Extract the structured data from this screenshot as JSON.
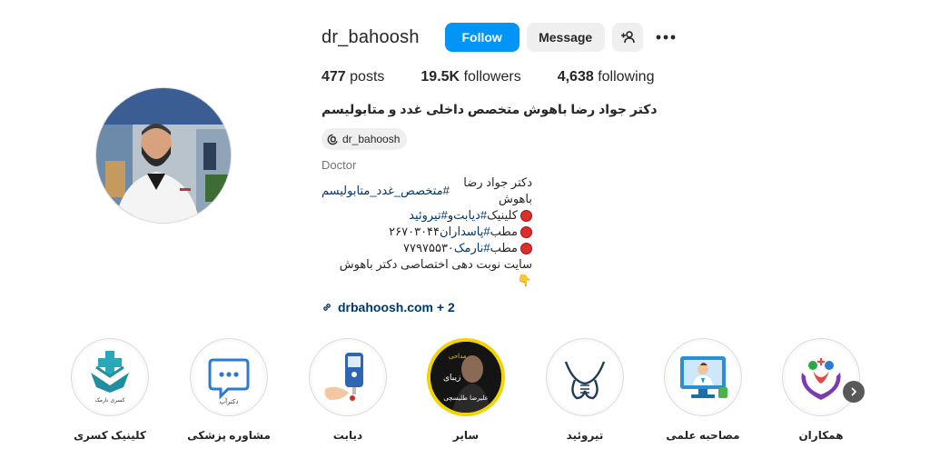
{
  "profile": {
    "username": "dr_bahoosh",
    "follow_label": "Follow",
    "message_label": "Message",
    "posts_count": "477",
    "posts_label": "posts",
    "followers_count": "19.5K",
    "followers_label": "followers",
    "following_count": "4,638",
    "following_label": "following",
    "full_name": "دکتر جواد رضا باهوش متخصص داخلی غدد و متابولیسم",
    "threads_handle": "dr_bahoosh",
    "category": "Doctor"
  },
  "bio": {
    "line1_text": "دکتر جواد رضا باهوش ",
    "line1_tag": "#متخصص_غدد_متابولیسم",
    "line2_text": "کلینیک ",
    "line2_tag1": "#دیابت",
    "line2_mid": " و ",
    "line2_tag2": "#تیروئید",
    "line3_text": "مطب",
    "line3_tag": "#پاسداران",
    "line3_num": " ۲۶۷۰۳۰۴۴",
    "line4_text": "مطب",
    "line4_tag": "#نارمک",
    "line4_num": " ۷۷۹۷۵۵۳۰",
    "line5_text": "سایت نوبت دهی اختصاصی دکتر باهوش",
    "line6_text": "👇"
  },
  "link": {
    "text": "drbahoosh.com + 2"
  },
  "highlights": [
    {
      "label": "کلینیک کسری",
      "icon": "clinic-logo-icon",
      "caption": "کسری نارمک"
    },
    {
      "label": "مشاوره پزشکی",
      "icon": "chat-bubble-icon",
      "caption": "دکترآپ"
    },
    {
      "label": "دیابت",
      "icon": "glucose-meter-icon"
    },
    {
      "label": "سایر",
      "icon": "portrait-poster-icon",
      "caption_top": "مداحی",
      "caption_mid": "زیبای",
      "caption_bottom": "علیرضا طلیسچی"
    },
    {
      "label": "تیروئید",
      "icon": "thyroid-icon"
    },
    {
      "label": "مصاحبه علمی",
      "icon": "doctor-monitor-icon"
    },
    {
      "label": "همکاران",
      "icon": "heart-hands-icon"
    }
  ],
  "colors": {
    "accent": "#0095f6",
    "link": "#00376b",
    "muted": "#737373"
  }
}
